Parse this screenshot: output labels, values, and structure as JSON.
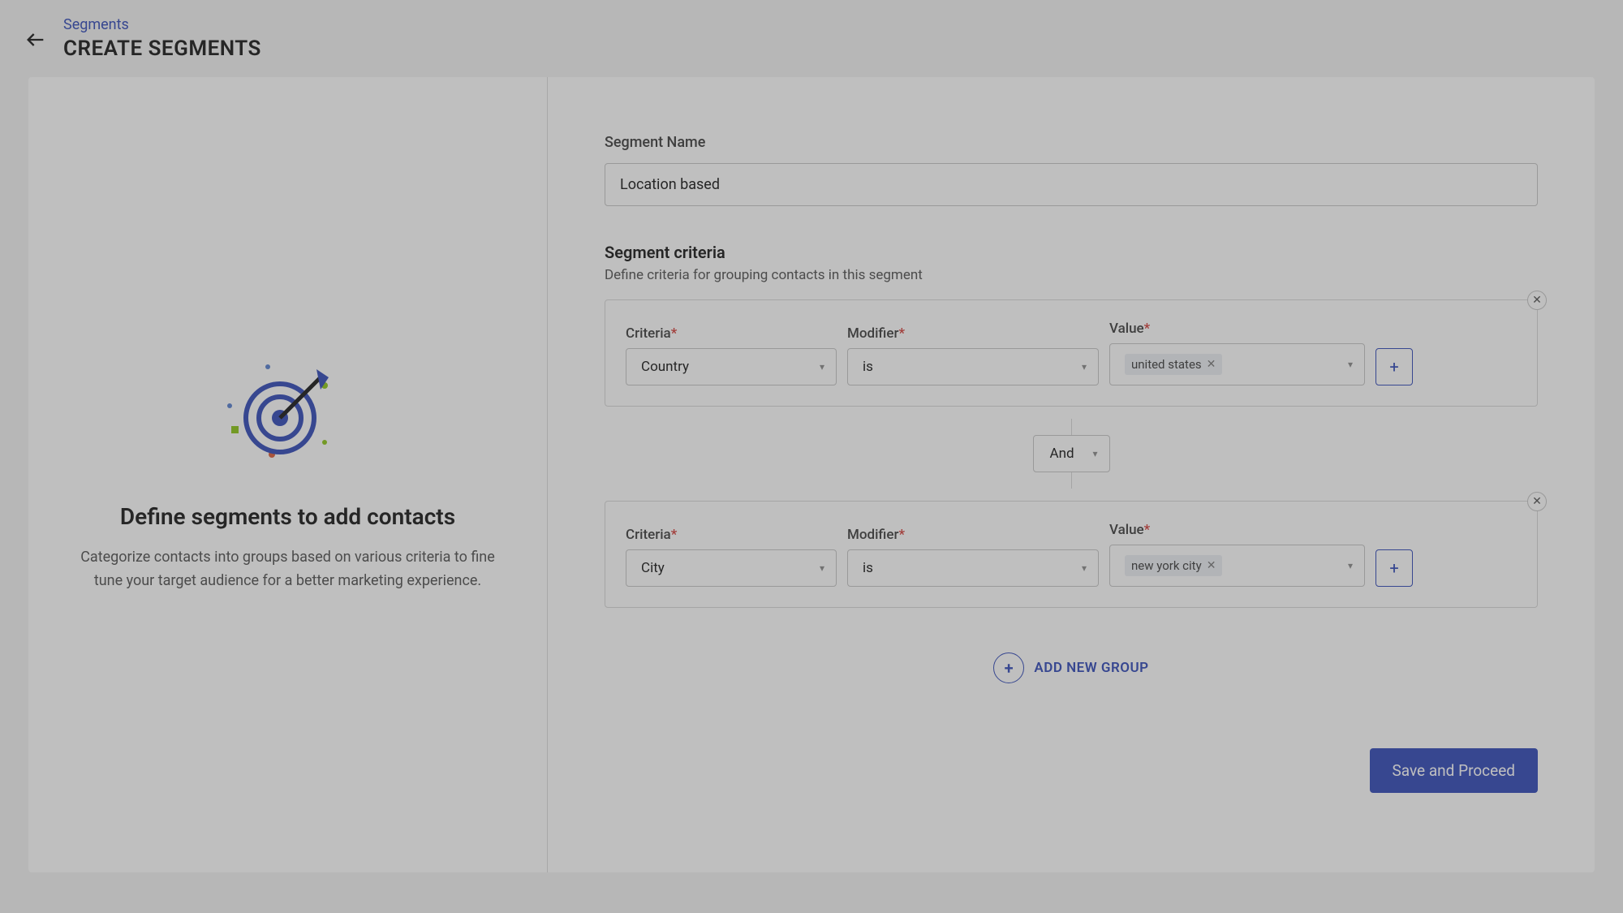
{
  "breadcrumb": {
    "parent": "Segments"
  },
  "page_title": "CREATE SEGMENTS",
  "left_panel": {
    "heading": "Define segments to add contacts",
    "description": "Categorize contacts into groups based on various criteria to fine tune your target audience for a better marketing experience."
  },
  "form": {
    "segment_name_label": "Segment Name",
    "segment_name_value": "Location based",
    "criteria_heading": "Segment criteria",
    "criteria_description": "Define criteria for grouping contacts in this segment",
    "labels": {
      "criteria": "Criteria",
      "modifier": "Modifier",
      "value": "Value"
    },
    "groups": [
      {
        "criteria": "Country",
        "modifier": "is",
        "value_tag": "united states"
      },
      {
        "criteria": "City",
        "modifier": "is",
        "value_tag": "new york city"
      }
    ],
    "connector": "And",
    "add_group_label": "ADD NEW GROUP",
    "save_button": "Save and Proceed"
  }
}
